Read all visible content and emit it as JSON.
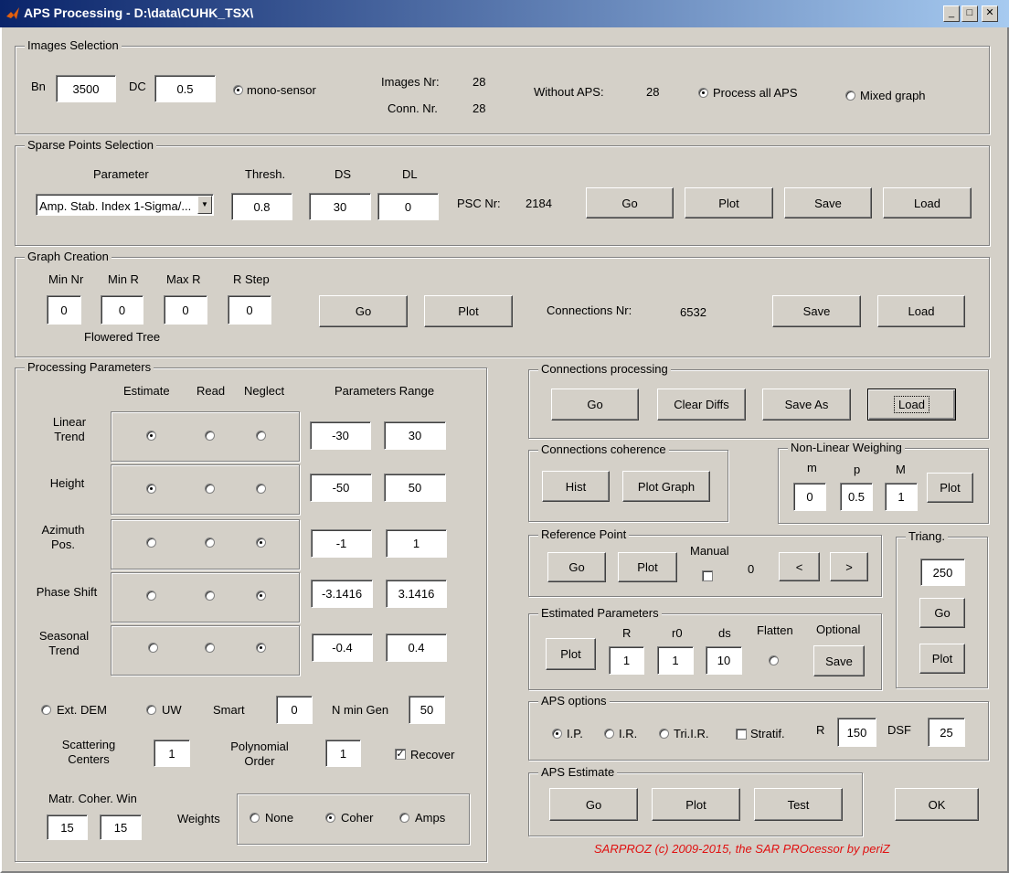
{
  "window": {
    "title": "APS Processing - D:\\data\\CUHK_TSX\\",
    "minimize": "_",
    "maximize": "□",
    "close": "✕"
  },
  "images_selection": {
    "title": "Images Selection",
    "bn_label": "Bn",
    "bn_value": "3500",
    "dc_label": "DC",
    "dc_value": "0.5",
    "mono_sensor": "mono-sensor",
    "images_nr_label": "Images Nr:",
    "images_nr": "28",
    "conn_nr_label": "Conn. Nr.",
    "conn_nr": "28",
    "without_aps_label": "Without APS:",
    "without_aps": "28",
    "process_all": "Process all APS",
    "mixed_graph": "Mixed graph"
  },
  "sparse_points": {
    "title": "Sparse Points Selection",
    "parameter_label": "Parameter",
    "parameter_value": "Amp. Stab. Index 1-Sigma/...",
    "thresh_label": "Thresh.",
    "thresh_value": "0.8",
    "ds_label": "DS",
    "ds_value": "30",
    "dl_label": "DL",
    "dl_value": "0",
    "psc_label": "PSC Nr:",
    "psc_value": "2184",
    "go": "Go",
    "plot": "Plot",
    "save": "Save",
    "load": "Load"
  },
  "graph_creation": {
    "title": "Graph Creation",
    "min_nr_label": "Min Nr",
    "min_nr": "0",
    "min_r_label": "Min R",
    "min_r": "0",
    "max_r_label": "Max R",
    "max_r": "0",
    "r_step_label": "R Step",
    "r_step": "0",
    "flowered_tree": "Flowered Tree",
    "go": "Go",
    "plot": "Plot",
    "connections_label": "Connections Nr:",
    "connections": "6532",
    "save": "Save",
    "load": "Load"
  },
  "processing": {
    "title": "Processing Parameters",
    "col_estimate": "Estimate",
    "col_read": "Read",
    "col_neglect": "Neglect",
    "col_range": "Parameters Range",
    "rows": [
      {
        "label": "Linear\nTrend",
        "min": "-30",
        "max": "30"
      },
      {
        "label": "Height",
        "min": "-50",
        "max": "50"
      },
      {
        "label": "Azimuth\nPos.",
        "min": "-1",
        "max": "1"
      },
      {
        "label": "Phase Shift",
        "min": "-3.1416",
        "max": "3.1416"
      },
      {
        "label": "Seasonal\nTrend",
        "min": "-0.4",
        "max": "0.4"
      }
    ],
    "ext_dem": "Ext. DEM",
    "uw": "UW",
    "smart_label": "Smart",
    "smart": "0",
    "n_min_gen_label": "N min Gen",
    "n_min_gen": "50",
    "scattering_label": "Scattering\nCenters",
    "scattering": "1",
    "poly_label": "Polynomial\nOrder",
    "poly": "1",
    "recover": "Recover",
    "matr_label": "Matr. Coher. Win",
    "matr_a": "15",
    "matr_b": "15",
    "weights_label": "Weights",
    "w_none": "None",
    "w_coher": "Coher",
    "w_amps": "Amps"
  },
  "conn_processing": {
    "title": "Connections processing",
    "go": "Go",
    "clear": "Clear Diffs",
    "save_as": "Save As",
    "load": "Load"
  },
  "conn_coherence": {
    "title": "Connections coherence",
    "hist": "Hist",
    "plot_graph": "Plot Graph"
  },
  "nonlinear": {
    "title": "Non-Linear Weighing",
    "m_label": "m",
    "m": "0",
    "p_label": "p",
    "p": "0.5",
    "M_label": "M",
    "M": "1",
    "plot": "Plot"
  },
  "reference": {
    "title": "Reference Point",
    "go": "Go",
    "plot": "Plot",
    "manual": "Manual",
    "value": "0",
    "prev": "<",
    "next": ">"
  },
  "triang": {
    "title": "Triang.",
    "value": "250",
    "go": "Go",
    "plot": "Plot"
  },
  "estimated": {
    "title": "Estimated Parameters",
    "plot": "Plot",
    "r_label": "R",
    "r": "1",
    "r0_label": "r0",
    "r0": "1",
    "ds_label": "ds",
    "ds": "10",
    "flatten": "Flatten",
    "optional": "Optional",
    "save": "Save"
  },
  "aps_options": {
    "title": "APS options",
    "ip": "I.P.",
    "ir": "I.R.",
    "trilr": "Tri.I.R.",
    "stratif": "Stratif.",
    "r_label": "R",
    "r": "150",
    "dsf_label": "DSF",
    "dsf": "25"
  },
  "aps_estimate": {
    "title": "APS Estimate",
    "go": "Go",
    "plot": "Plot",
    "test": "Test"
  },
  "ok": "OK",
  "footer": "SARPROZ (c) 2009-2015, the SAR PROcessor by periZ"
}
